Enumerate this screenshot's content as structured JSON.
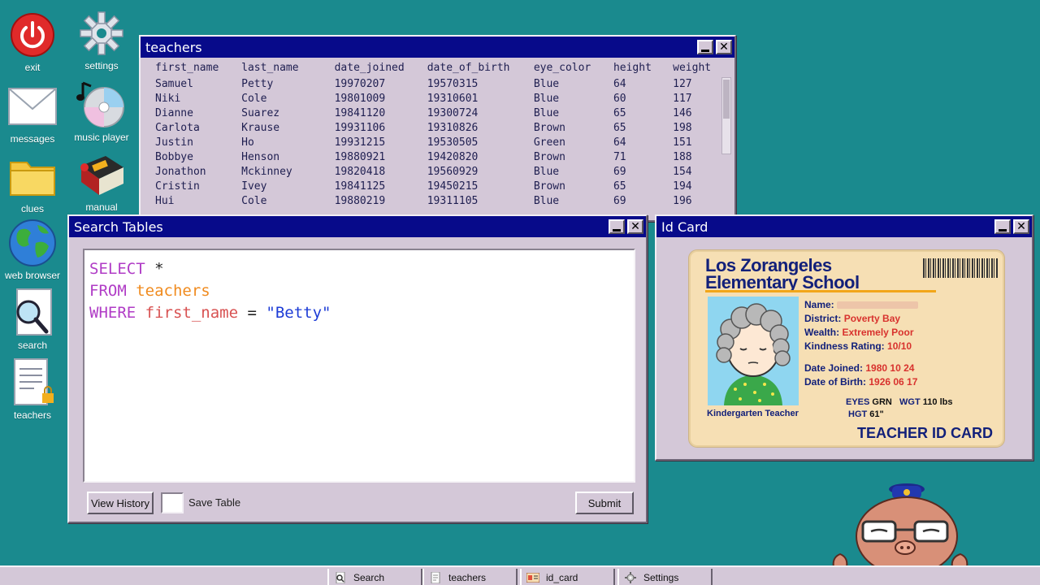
{
  "colors": {
    "desktop": "#1a8a8e",
    "titlebar": "#070a8a",
    "window": "#d4c8d8"
  },
  "desktop_icons": [
    {
      "label": "exit",
      "icon": "power-icon"
    },
    {
      "label": "settings",
      "icon": "gear-icon"
    },
    {
      "label": "messages",
      "icon": "envelope-icon"
    },
    {
      "label": "music player",
      "icon": "cd-music-icon"
    },
    {
      "label": "clues",
      "icon": "folder-icon"
    },
    {
      "label": "manual",
      "icon": "book-icon"
    },
    {
      "label": "web browser",
      "icon": "globe-icon"
    },
    {
      "label": "search",
      "icon": "magnifier-document-icon"
    },
    {
      "label": "teachers",
      "icon": "locked-document-icon"
    }
  ],
  "teachers_window": {
    "title": "teachers",
    "columns": [
      "first_name",
      "last_name",
      "date_joined",
      "date_of_birth",
      "eye_color",
      "height",
      "weight"
    ],
    "rows": [
      [
        "Samuel",
        "Petty",
        "19970207",
        "19570315",
        "Blue",
        "64",
        "127"
      ],
      [
        "Niki",
        "Cole",
        "19801009",
        "19310601",
        "Blue",
        "60",
        "117"
      ],
      [
        "Dianne",
        "Suarez",
        "19841120",
        "19300724",
        "Blue",
        "65",
        "146"
      ],
      [
        "Carlota",
        "Krause",
        "19931106",
        "19310826",
        "Brown",
        "65",
        "198"
      ],
      [
        "Justin",
        "Ho",
        "19931215",
        "19530505",
        "Green",
        "64",
        "151"
      ],
      [
        "Bobbye",
        "Henson",
        "19880921",
        "19420820",
        "Brown",
        "71",
        "188"
      ],
      [
        "Jonathon",
        "Mckinney",
        "19820418",
        "19560929",
        "Blue",
        "69",
        "154"
      ],
      [
        "Cristin",
        "Ivey",
        "19841125",
        "19450215",
        "Brown",
        "65",
        "194"
      ],
      [
        "Hui",
        "Cole",
        "19880219",
        "19311105",
        "Blue",
        "69",
        "196"
      ]
    ]
  },
  "search_window": {
    "title": "Search Tables",
    "query": {
      "select_kw": "SELECT",
      "select_val": "*",
      "from_kw": "FROM",
      "table": "teachers",
      "where_kw": "WHERE",
      "column": "first_name",
      "operator": "=",
      "value": "\"Betty\""
    },
    "view_history_label": "View History",
    "save_table_label": "Save Table",
    "submit_label": "Submit"
  },
  "id_window": {
    "title": "Id Card",
    "school_line1": "Los Zorangeles",
    "school_line2": "Elementary School",
    "name_label": "Name:",
    "district_label": "District:",
    "district_value": "Poverty Bay",
    "wealth_label": "Wealth:",
    "wealth_value": "Extremely Poor",
    "kindness_label": "Kindness Rating:",
    "kindness_value": "10/10",
    "joined_label": "Date Joined:",
    "joined_value": "1980 10 24",
    "dob_label": "Date of Birth:",
    "dob_value": "1926 06 17",
    "eyes_label": "EYES",
    "eyes_value": "GRN",
    "wgt_label": "WGT",
    "wgt_value": "110 lbs",
    "hgt_label": "HGT",
    "hgt_value": "61\"",
    "role": "Kindergarten Teacher",
    "card_title": "TEACHER ID CARD"
  },
  "taskbar": [
    {
      "label": "Search",
      "icon": "search-icon"
    },
    {
      "label": "teachers",
      "icon": "document-icon"
    },
    {
      "label": "id_card",
      "icon": "id-card-icon"
    },
    {
      "label": "Settings",
      "icon": "gear-icon"
    }
  ]
}
